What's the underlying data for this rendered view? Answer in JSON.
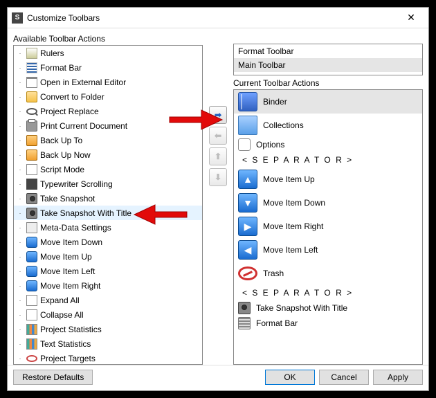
{
  "titlebar": {
    "icon_text": "S",
    "title": "Customize Toolbars",
    "close": "✕"
  },
  "labels": {
    "available": "Available Toolbar Actions",
    "current": "Current Toolbar Actions"
  },
  "toolbars": {
    "items": [
      {
        "label": "Format Toolbar",
        "selected": false
      },
      {
        "label": "Main Toolbar",
        "selected": true
      }
    ]
  },
  "available_actions": {
    "items": [
      {
        "label": "Rulers",
        "icon": "i-ruler"
      },
      {
        "label": "Format Bar",
        "icon": "i-lines"
      },
      {
        "label": "Open in External Editor",
        "icon": "i-doc"
      },
      {
        "label": "Convert to Folder",
        "icon": "i-folder"
      },
      {
        "label": "Project Replace",
        "icon": "i-search"
      },
      {
        "label": "Print Current Document",
        "icon": "i-printer"
      },
      {
        "label": "Back Up To",
        "icon": "i-backup"
      },
      {
        "label": "Back Up Now",
        "icon": "i-backup"
      },
      {
        "label": "Script Mode",
        "icon": "i-script"
      },
      {
        "label": "Typewriter Scrolling",
        "icon": "i-type"
      },
      {
        "label": "Take Snapshot",
        "icon": "i-camera"
      },
      {
        "label": "Take Snapshot With Title",
        "icon": "i-camera",
        "selected": true
      },
      {
        "label": "Meta-Data Settings",
        "icon": "i-meta"
      },
      {
        "label": "Move Item Down",
        "icon": "i-arrow-d"
      },
      {
        "label": "Move Item Up",
        "icon": "i-arrow-u"
      },
      {
        "label": "Move Item Left",
        "icon": "i-arrow-l"
      },
      {
        "label": "Move Item Right",
        "icon": "i-arrow-r"
      },
      {
        "label": "Expand All",
        "icon": "i-expand"
      },
      {
        "label": "Collapse All",
        "icon": "i-collapse"
      },
      {
        "label": "Project Statistics",
        "icon": "i-stats"
      },
      {
        "label": "Text Statistics",
        "icon": "i-stats"
      },
      {
        "label": "Project Targets",
        "icon": "i-target"
      }
    ]
  },
  "current_actions": {
    "items": [
      {
        "label": "Binder",
        "icon": "i-binder",
        "selected": true
      },
      {
        "label": "Collections",
        "icon": "i-folderblue"
      },
      {
        "label": "Options",
        "icon": "i-options",
        "small": true
      },
      {
        "type": "separator"
      },
      {
        "label": "Move Item Up",
        "icon": "i-arrow-u",
        "glyph": "▲"
      },
      {
        "label": "Move Item Down",
        "icon": "i-arrow-d",
        "glyph": "▼"
      },
      {
        "label": "Move Item Right",
        "icon": "i-arrow-r",
        "glyph": "▶"
      },
      {
        "label": "Move Item Left",
        "icon": "i-arrow-l",
        "glyph": "◀"
      },
      {
        "label": "Trash",
        "icon": "i-trash"
      },
      {
        "type": "separator"
      },
      {
        "label": "Take Snapshot With Title",
        "icon": "i-camera",
        "small": true
      },
      {
        "label": "Format Bar",
        "icon": "i-formatbar",
        "small": true
      }
    ]
  },
  "separator_text": "< S E P A R A T O R >",
  "mid_buttons": {
    "right": "➡",
    "left": "⬅",
    "up": "⬆",
    "down": "⬇"
  },
  "footer": {
    "restore": "Restore Defaults",
    "ok": "OK",
    "cancel": "Cancel",
    "apply": "Apply"
  }
}
